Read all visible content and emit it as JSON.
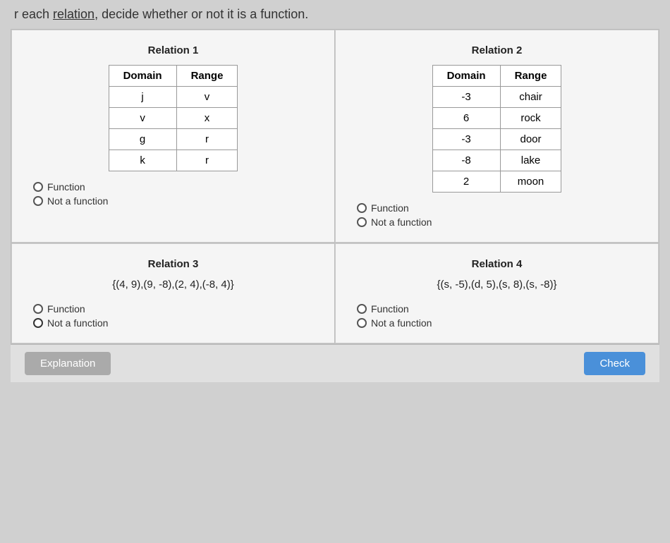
{
  "header": {
    "text": "r each relation, decide whether or not it is a function.",
    "underline": "relation"
  },
  "relation1": {
    "title": "Relation 1",
    "table": {
      "headers": [
        "Domain",
        "Range"
      ],
      "rows": [
        [
          "j",
          "v"
        ],
        [
          "v",
          "x"
        ],
        [
          "g",
          "r"
        ],
        [
          "k",
          "r"
        ]
      ]
    },
    "options": [
      "Function",
      "Not a function"
    ]
  },
  "relation2": {
    "title": "Relation 2",
    "table": {
      "headers": [
        "Domain",
        "Range"
      ],
      "rows": [
        [
          "-3",
          "chair"
        ],
        [
          "6",
          "rock"
        ],
        [
          "-3",
          "door"
        ],
        [
          "-8",
          "lake"
        ],
        [
          "2",
          "moon"
        ]
      ]
    },
    "options": [
      "Function",
      "Not a function"
    ]
  },
  "relation3": {
    "title": "Relation 3",
    "set": "{(4, 9),(9, -8),(2, 4),(-8, 4)}",
    "options": [
      "Function",
      "Not a function"
    ],
    "selected": "Not a function"
  },
  "relation4": {
    "title": "Relation 4",
    "set": "{(s, -5),(d, 5),(s, 8),(s, -8)}",
    "options": [
      "Function",
      "Not a function"
    ],
    "selected": "Not a function"
  },
  "footer": {
    "explanation_label": "Explanation",
    "check_label": "Check"
  }
}
